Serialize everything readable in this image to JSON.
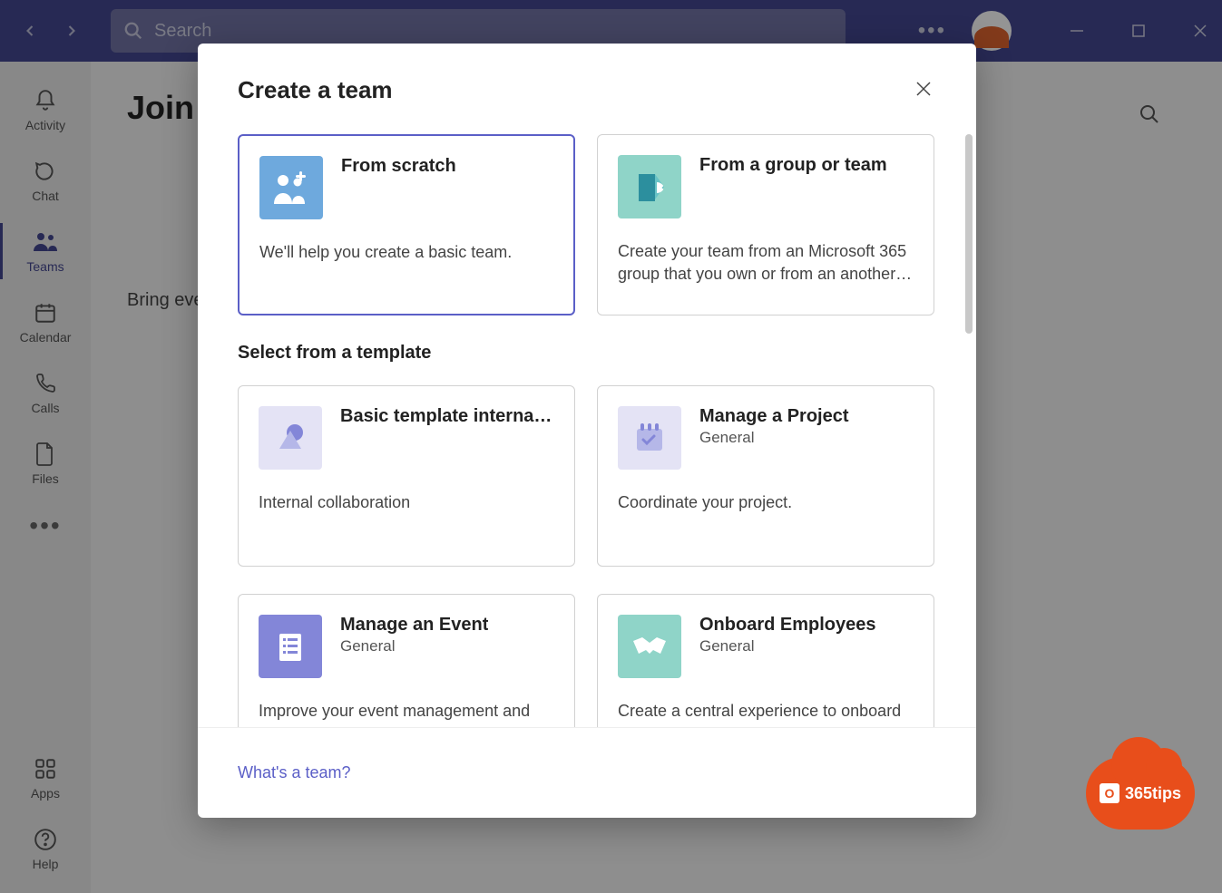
{
  "titlebar": {
    "search_placeholder": "Search"
  },
  "rail": {
    "items": [
      {
        "label": "Activity",
        "icon": "bell"
      },
      {
        "label": "Chat",
        "icon": "chat"
      },
      {
        "label": "Teams",
        "icon": "teams",
        "active": true
      },
      {
        "label": "Calendar",
        "icon": "calendar"
      },
      {
        "label": "Calls",
        "icon": "calls"
      },
      {
        "label": "Files",
        "icon": "files"
      }
    ],
    "apps_label": "Apps",
    "help_label": "Help"
  },
  "main": {
    "heading": "Join or create a team",
    "bring_text": "Bring everyone together and get to work!"
  },
  "modal": {
    "title": "Create a team",
    "template_section": "Select from a template",
    "footer_link": "What's a team?",
    "options": [
      {
        "title": "From scratch",
        "desc": "We'll help you create a basic team."
      },
      {
        "title": "From a group or team",
        "desc": "Create your team from an Microsoft 365 group that you own or from an another…"
      }
    ],
    "templates": [
      {
        "title": "Basic template internal…",
        "sub": "",
        "desc": "Internal collaboration"
      },
      {
        "title": "Manage a Project",
        "sub": "General",
        "desc": "Coordinate your project."
      },
      {
        "title": "Manage an Event",
        "sub": "General",
        "desc": "Improve your event management and"
      },
      {
        "title": "Onboard Employees",
        "sub": "General",
        "desc": "Create a central experience to onboard"
      }
    ]
  },
  "badge": {
    "text": "365tips"
  }
}
